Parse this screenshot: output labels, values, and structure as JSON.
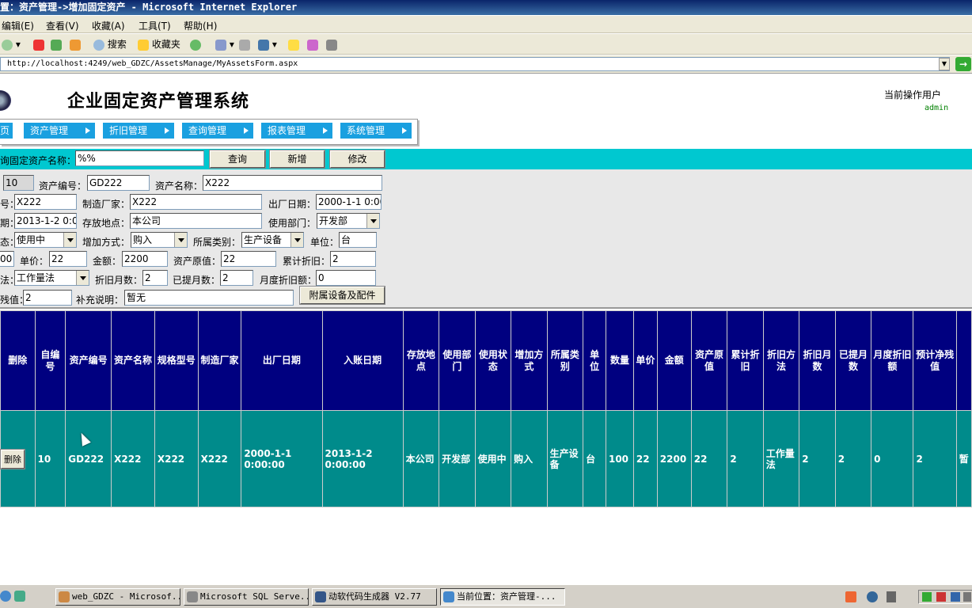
{
  "window": {
    "title": "置：资产管理->增加固定资产 - Microsoft Internet Explorer"
  },
  "menu": [
    "编辑(E)",
    "查看(V)",
    "收藏(A)",
    "工具(T)",
    "帮助(H)"
  ],
  "toolbar": {
    "search_label": "搜索",
    "favorites_label": "收藏夹"
  },
  "address": {
    "url": "http://localhost:4249/web_GDZC/AssetsManage/MyAssetsForm.aspx"
  },
  "header": {
    "app_title": "企业固定资产管理系统",
    "user_label": "当前操作用户",
    "user_name": "admin"
  },
  "nav": [
    "页",
    "资产管理",
    "折旧管理",
    "查询管理",
    "报表管理",
    "系统管理"
  ],
  "search": {
    "label": "询固定资产名称：",
    "value": "%%",
    "query_button": "查询",
    "add_button": "新增",
    "edit_button": "修改"
  },
  "form": {
    "id_value": "10",
    "asset_code_label": "资产编号：",
    "asset_code_value": "GD222",
    "asset_name_label": "资产名称：",
    "asset_name_value": "X222",
    "model_label": "号：",
    "model_value": "X222",
    "maker_label": "制造厂家：",
    "maker_value": "X222",
    "factory_date_label": "出厂日期：",
    "factory_date_value": "2000-1-1 0:00",
    "entry_date_label": "期：",
    "entry_date_value": "2013-1-2 0:00",
    "location_label": "存放地点：",
    "location_value": "本公司",
    "dept_label": "使用部门：",
    "dept_value": "开发部",
    "status_label": "态：",
    "status_value": "使用中",
    "add_method_label": "增加方式：",
    "add_method_value": "购入",
    "category_label": "所属类别：",
    "category_value": "生产设备",
    "unit_label": "单位：",
    "unit_value": "台",
    "qty_value": "00",
    "price_label": "单价：",
    "price_value": "22",
    "amount_label": "金额：",
    "amount_value": "2200",
    "original_label": "资产原值：",
    "original_value": "22",
    "accum_dep_label": "累计折旧：",
    "accum_dep_value": "2",
    "dep_method_label": "法：",
    "dep_method_value": "工作量法",
    "dep_months_label": "折旧月数：",
    "dep_months_value": "2",
    "months_taken_label": "已提月数：",
    "months_taken_value": "2",
    "monthly_dep_label": "月度折旧额：",
    "monthly_dep_value": "0",
    "residual_label": "残值：",
    "residual_value": "2",
    "note_label": "补充说明：",
    "note_value": "暂无",
    "accessories_button": "附属设备及配件"
  },
  "table": {
    "headers": [
      "删除",
      "自编号",
      "资产编号",
      "资产名称",
      "规格型号",
      "制造厂家",
      "出厂日期",
      "入账日期",
      "存放地点",
      "使用部门",
      "使用状态",
      "增加方式",
      "所属类别",
      "单位",
      "数量",
      "单价",
      "金额",
      "资产原值",
      "累计折旧",
      "折旧方法",
      "折旧月数",
      "已提月数",
      "月度折旧额",
      "预计净残值",
      ""
    ],
    "row": {
      "delete_button": "删除",
      "cells": [
        "10",
        "GD222",
        "X222",
        "X222",
        "X222",
        "2000-1-1 0:00:00",
        "2013-1-2 0:00:00",
        "本公司",
        "开发部",
        "使用中",
        "购入",
        "生产设备",
        "台",
        "100",
        "22",
        "2200",
        "22",
        "2",
        "工作量法",
        "2",
        "2",
        "0",
        "2",
        "暂"
      ]
    }
  },
  "taskbar": [
    "web_GDZC - Microsof...",
    "Microsoft SQL Serve...",
    "动软代码生成器  V2.77",
    "当前位置：资产管理-..."
  ]
}
